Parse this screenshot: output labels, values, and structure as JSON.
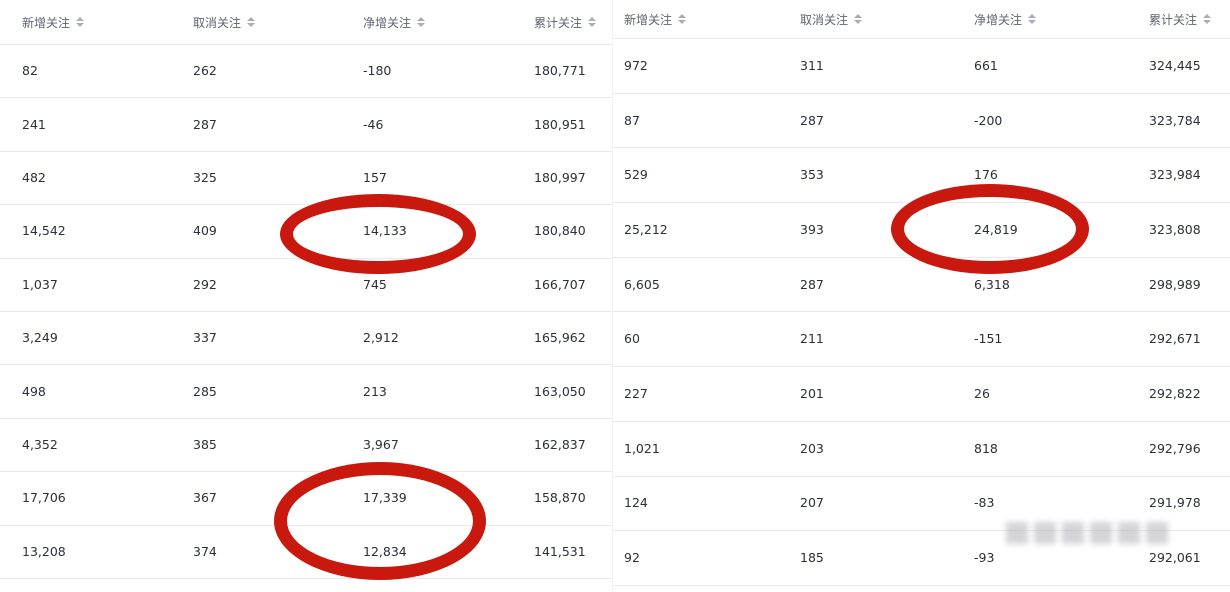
{
  "tables": [
    {
      "name": "left",
      "headers": [
        "新增关注",
        "取消关注",
        "净增关注",
        "累计关注"
      ],
      "rows": [
        [
          "82",
          "262",
          "-180",
          "180,771"
        ],
        [
          "241",
          "287",
          "-46",
          "180,951"
        ],
        [
          "482",
          "325",
          "157",
          "180,997"
        ],
        [
          "14,542",
          "409",
          "14,133",
          "180,840"
        ],
        [
          "1,037",
          "292",
          "745",
          "166,707"
        ],
        [
          "3,249",
          "337",
          "2,912",
          "165,962"
        ],
        [
          "498",
          "285",
          "213",
          "163,050"
        ],
        [
          "4,352",
          "385",
          "3,967",
          "162,837"
        ],
        [
          "17,706",
          "367",
          "17,339",
          "158,870"
        ],
        [
          "13,208",
          "374",
          "12,834",
          "141,531"
        ]
      ]
    },
    {
      "name": "right",
      "headers": [
        "新增关注",
        "取消关注",
        "净增关注",
        "累计关注"
      ],
      "rows": [
        [
          "972",
          "311",
          "661",
          "324,445"
        ],
        [
          "87",
          "287",
          "-200",
          "323,784"
        ],
        [
          "529",
          "353",
          "176",
          "323,984"
        ],
        [
          "25,212",
          "393",
          "24,819",
          "323,808"
        ],
        [
          "6,605",
          "287",
          "6,318",
          "298,989"
        ],
        [
          "60",
          "211",
          "-151",
          "292,671"
        ],
        [
          "227",
          "201",
          "26",
          "292,822"
        ],
        [
          "1,021",
          "203",
          "818",
          "292,796"
        ],
        [
          "124",
          "207",
          "-83",
          "291,978"
        ],
        [
          "92",
          "185",
          "-93",
          "292,061"
        ]
      ]
    }
  ],
  "colors": {
    "highlight_ring": "#c9180d",
    "header_text": "#5f6472",
    "body_text": "#2b2f3a",
    "row_border": "#e9e9ee",
    "sort_icon": "#a9adb8"
  },
  "icons": {
    "sort": "sort-icon"
  }
}
